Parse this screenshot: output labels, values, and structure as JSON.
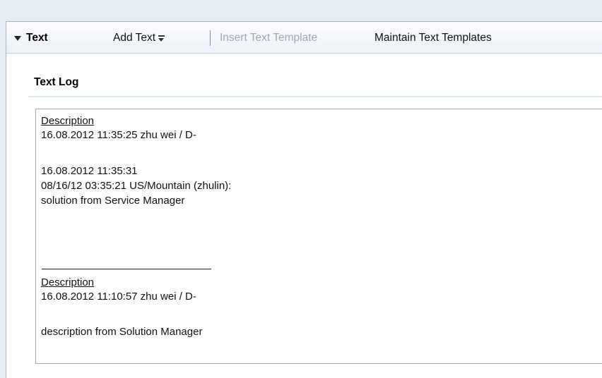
{
  "toolbar": {
    "section_title": "Text",
    "add_text": "Add Text",
    "insert_template": "Insert Text Template",
    "maintain_templates": "Maintain Text Templates"
  },
  "text_log": {
    "title": "Text Log",
    "entries": [
      {
        "heading": "Description",
        "meta": "16.08.2012   11:35:25   zhu wei / D-",
        "lines": [
          "16.08.2012  11:35:31",
          "08/16/12 03:35:21 US/Mountain (zhulin):",
          "solution from Service Manager"
        ]
      },
      {
        "heading": "Description",
        "meta": "16.08.2012   11:10:57   zhu wei / D-",
        "lines": [
          "description from Solution Manager"
        ]
      }
    ]
  }
}
